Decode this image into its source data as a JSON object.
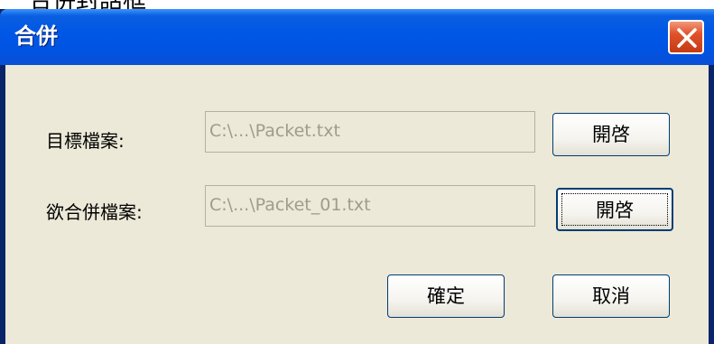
{
  "background_caption": "合併封話框",
  "window": {
    "title": "合併",
    "close_icon": "close-x-icon"
  },
  "target_file": {
    "label": "目標檔案:",
    "value": "C:\\...\\Packet.txt",
    "open_button": "開啓"
  },
  "merge_file": {
    "label": "欲合併檔案:",
    "value": "C:\\...\\Packet_01.txt",
    "open_button": "開啓"
  },
  "actions": {
    "ok": "確定",
    "cancel": "取消"
  },
  "colors": {
    "titlebar": "#0054e3",
    "client": "#ece9d8",
    "close_button": "#e0522b",
    "button_border": "#003c74"
  }
}
